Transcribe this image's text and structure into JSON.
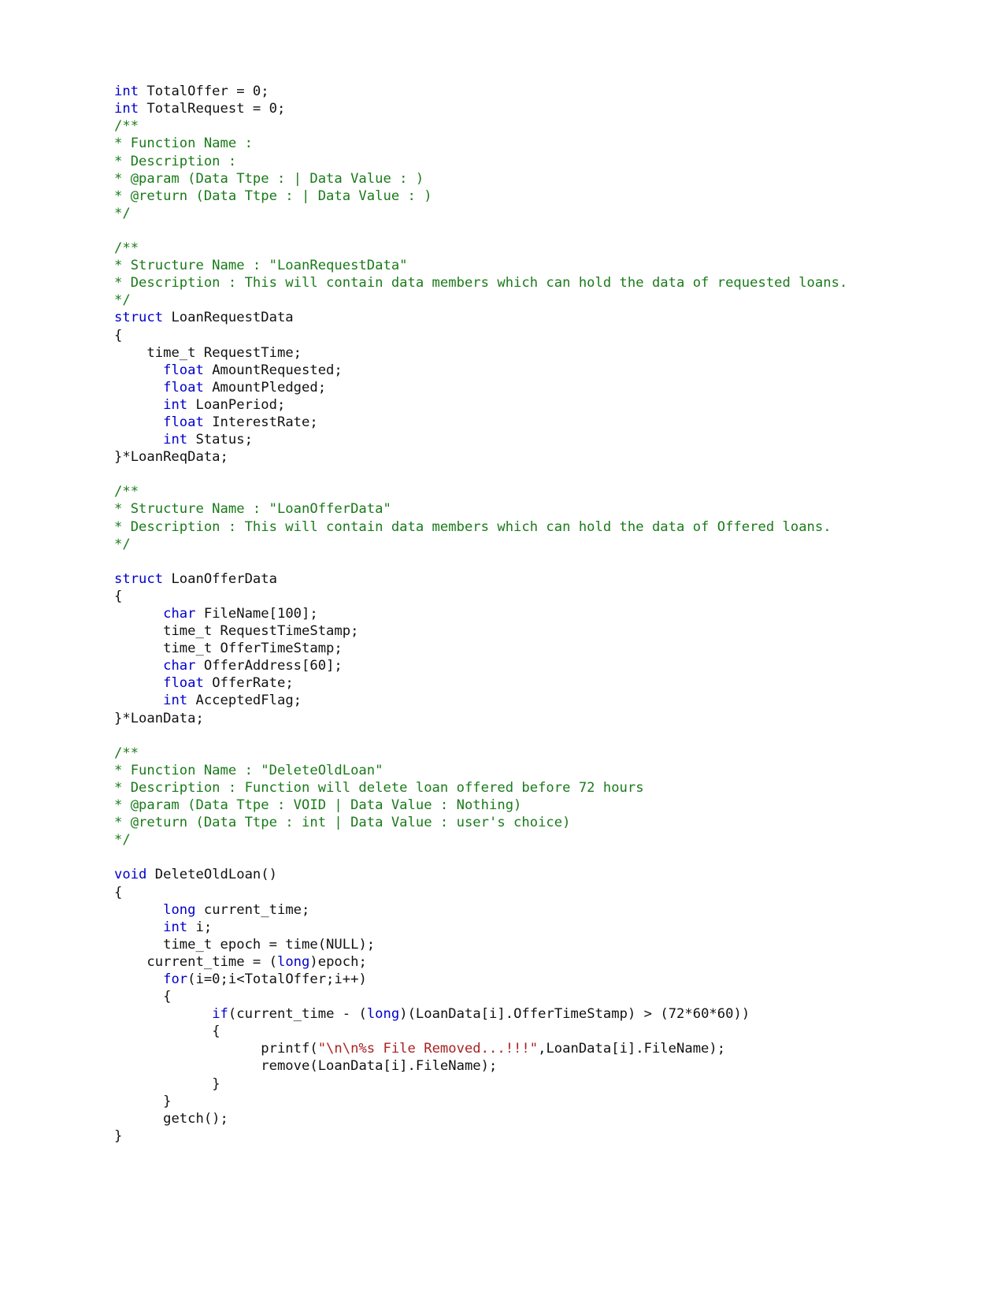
{
  "document": {
    "kind": "source-code-listing",
    "language": "C",
    "background_color": "#ffffff"
  },
  "syntax_colors": {
    "keyword": "#0000cd",
    "comment": "#1a7a1a",
    "string": "#aa2222",
    "plain": "#111111"
  },
  "code": {
    "lines": [
      {
        "id": "l1",
        "tokens": [
          {
            "t": "int",
            "c": "kw"
          },
          {
            "t": " TotalOffer = 0;",
            "c": "txt"
          }
        ]
      },
      {
        "id": "l2",
        "tokens": [
          {
            "t": "int",
            "c": "kw"
          },
          {
            "t": " TotalRequest = 0;",
            "c": "txt"
          }
        ]
      },
      {
        "id": "l3",
        "tokens": [
          {
            "t": "/**",
            "c": "cmt"
          }
        ]
      },
      {
        "id": "l4",
        "tokens": [
          {
            "t": "* Function Name :",
            "c": "cmt"
          }
        ]
      },
      {
        "id": "l5",
        "tokens": [
          {
            "t": "* Description :",
            "c": "cmt"
          }
        ]
      },
      {
        "id": "l6",
        "tokens": [
          {
            "t": "* @param (Data Ttpe : | Data Value : )",
            "c": "cmt"
          }
        ]
      },
      {
        "id": "l7",
        "tokens": [
          {
            "t": "* @return (Data Ttpe : | Data Value : )",
            "c": "cmt"
          }
        ]
      },
      {
        "id": "l8",
        "tokens": [
          {
            "t": "*/",
            "c": "cmt"
          }
        ]
      },
      {
        "id": "l9",
        "tokens": []
      },
      {
        "id": "l10",
        "tokens": [
          {
            "t": "/**",
            "c": "cmt"
          }
        ]
      },
      {
        "id": "l11",
        "tokens": [
          {
            "t": "* Structure Name : \"LoanRequestData\"",
            "c": "cmt"
          }
        ]
      },
      {
        "id": "l12",
        "tokens": [
          {
            "t": "* Description : This will contain data members which can hold the data of requested loans.",
            "c": "cmt"
          }
        ]
      },
      {
        "id": "l13",
        "tokens": [
          {
            "t": "*/",
            "c": "cmt"
          }
        ]
      },
      {
        "id": "l14",
        "tokens": [
          {
            "t": "struct",
            "c": "kw"
          },
          {
            "t": " LoanRequestData",
            "c": "txt"
          }
        ]
      },
      {
        "id": "l15",
        "tokens": [
          {
            "t": "{",
            "c": "txt"
          }
        ]
      },
      {
        "id": "l16",
        "tokens": [
          {
            "t": "    time_t RequestTime;",
            "c": "txt"
          }
        ]
      },
      {
        "id": "l17",
        "tokens": [
          {
            "t": "      ",
            "c": "txt"
          },
          {
            "t": "float",
            "c": "kw"
          },
          {
            "t": " AmountRequested;",
            "c": "txt"
          }
        ]
      },
      {
        "id": "l18",
        "tokens": [
          {
            "t": "      ",
            "c": "txt"
          },
          {
            "t": "float",
            "c": "kw"
          },
          {
            "t": " AmountPledged;",
            "c": "txt"
          }
        ]
      },
      {
        "id": "l19",
        "tokens": [
          {
            "t": "      ",
            "c": "txt"
          },
          {
            "t": "int",
            "c": "kw"
          },
          {
            "t": " LoanPeriod;",
            "c": "txt"
          }
        ]
      },
      {
        "id": "l20",
        "tokens": [
          {
            "t": "      ",
            "c": "txt"
          },
          {
            "t": "float",
            "c": "kw"
          },
          {
            "t": " InterestRate;",
            "c": "txt"
          }
        ]
      },
      {
        "id": "l21",
        "tokens": [
          {
            "t": "      ",
            "c": "txt"
          },
          {
            "t": "int",
            "c": "kw"
          },
          {
            "t": " Status;",
            "c": "txt"
          }
        ]
      },
      {
        "id": "l22",
        "tokens": [
          {
            "t": "}*LoanReqData;",
            "c": "txt"
          }
        ]
      },
      {
        "id": "l23",
        "tokens": []
      },
      {
        "id": "l24",
        "tokens": [
          {
            "t": "/**",
            "c": "cmt"
          }
        ]
      },
      {
        "id": "l25",
        "tokens": [
          {
            "t": "* Structure Name : \"LoanOfferData\"",
            "c": "cmt"
          }
        ]
      },
      {
        "id": "l26",
        "tokens": [
          {
            "t": "* Description : This will contain data members which can hold the data of Offered loans.",
            "c": "cmt"
          }
        ]
      },
      {
        "id": "l27",
        "tokens": [
          {
            "t": "*/",
            "c": "cmt"
          }
        ]
      },
      {
        "id": "l28",
        "tokens": []
      },
      {
        "id": "l29",
        "tokens": [
          {
            "t": "struct",
            "c": "kw"
          },
          {
            "t": " LoanOfferData",
            "c": "txt"
          }
        ]
      },
      {
        "id": "l30",
        "tokens": [
          {
            "t": "{",
            "c": "txt"
          }
        ]
      },
      {
        "id": "l31",
        "tokens": [
          {
            "t": "      ",
            "c": "txt"
          },
          {
            "t": "char",
            "c": "kw"
          },
          {
            "t": " FileName[100];",
            "c": "txt"
          }
        ]
      },
      {
        "id": "l32",
        "tokens": [
          {
            "t": "      time_t RequestTimeStamp;",
            "c": "txt"
          }
        ]
      },
      {
        "id": "l33",
        "tokens": [
          {
            "t": "      time_t OfferTimeStamp;",
            "c": "txt"
          }
        ]
      },
      {
        "id": "l34",
        "tokens": [
          {
            "t": "      ",
            "c": "txt"
          },
          {
            "t": "char",
            "c": "kw"
          },
          {
            "t": " OfferAddress[60];",
            "c": "txt"
          }
        ]
      },
      {
        "id": "l35",
        "tokens": [
          {
            "t": "      ",
            "c": "txt"
          },
          {
            "t": "float",
            "c": "kw"
          },
          {
            "t": " OfferRate;",
            "c": "txt"
          }
        ]
      },
      {
        "id": "l36",
        "tokens": [
          {
            "t": "      ",
            "c": "txt"
          },
          {
            "t": "int",
            "c": "kw"
          },
          {
            "t": " AcceptedFlag;",
            "c": "txt"
          }
        ]
      },
      {
        "id": "l37",
        "tokens": [
          {
            "t": "}*LoanData;",
            "c": "txt"
          }
        ]
      },
      {
        "id": "l38",
        "tokens": []
      },
      {
        "id": "l39",
        "tokens": [
          {
            "t": "/**",
            "c": "cmt"
          }
        ]
      },
      {
        "id": "l40",
        "tokens": [
          {
            "t": "* Function Name : \"DeleteOldLoan\"",
            "c": "cmt"
          }
        ]
      },
      {
        "id": "l41",
        "tokens": [
          {
            "t": "* Description : Function will delete loan offered before 72 hours",
            "c": "cmt"
          }
        ]
      },
      {
        "id": "l42",
        "tokens": [
          {
            "t": "* @param (Data Ttpe : VOID | Data Value : Nothing)",
            "c": "cmt"
          }
        ]
      },
      {
        "id": "l43",
        "tokens": [
          {
            "t": "* @return (Data Ttpe : int | Data Value : user's choice)",
            "c": "cmt"
          }
        ]
      },
      {
        "id": "l44",
        "tokens": [
          {
            "t": "*/",
            "c": "cmt"
          }
        ]
      },
      {
        "id": "l45",
        "tokens": []
      },
      {
        "id": "l46",
        "tokens": [
          {
            "t": "void",
            "c": "kw"
          },
          {
            "t": " DeleteOldLoan()",
            "c": "txt"
          }
        ]
      },
      {
        "id": "l47",
        "tokens": [
          {
            "t": "{",
            "c": "txt"
          }
        ]
      },
      {
        "id": "l48",
        "tokens": [
          {
            "t": "      ",
            "c": "txt"
          },
          {
            "t": "long",
            "c": "kw"
          },
          {
            "t": " current_time;",
            "c": "txt"
          }
        ]
      },
      {
        "id": "l49",
        "tokens": [
          {
            "t": "      ",
            "c": "txt"
          },
          {
            "t": "int",
            "c": "kw"
          },
          {
            "t": " i;",
            "c": "txt"
          }
        ]
      },
      {
        "id": "l50",
        "tokens": [
          {
            "t": "      time_t epoch = time(NULL);",
            "c": "txt"
          }
        ]
      },
      {
        "id": "l51",
        "tokens": [
          {
            "t": "    current_time = (",
            "c": "txt"
          },
          {
            "t": "long",
            "c": "kw"
          },
          {
            "t": ")epoch;",
            "c": "txt"
          }
        ]
      },
      {
        "id": "l52",
        "tokens": [
          {
            "t": "      ",
            "c": "txt"
          },
          {
            "t": "for",
            "c": "kw"
          },
          {
            "t": "(i=0;i<TotalOffer;i++)",
            "c": "txt"
          }
        ]
      },
      {
        "id": "l53",
        "tokens": [
          {
            "t": "      {",
            "c": "txt"
          }
        ]
      },
      {
        "id": "l54",
        "tokens": [
          {
            "t": "            ",
            "c": "txt"
          },
          {
            "t": "if",
            "c": "kw"
          },
          {
            "t": "(current_time - (",
            "c": "txt"
          },
          {
            "t": "long",
            "c": "kw"
          },
          {
            "t": ")(LoanData[i].OfferTimeStamp) > (72*60*60))",
            "c": "txt"
          }
        ]
      },
      {
        "id": "l55",
        "tokens": [
          {
            "t": "            {",
            "c": "txt"
          }
        ]
      },
      {
        "id": "l56",
        "tokens": [
          {
            "t": "                  printf(",
            "c": "txt"
          },
          {
            "t": "\"\\n\\n%s File Removed...!!!\"",
            "c": "str"
          },
          {
            "t": ",LoanData[i].FileName);",
            "c": "txt"
          }
        ]
      },
      {
        "id": "l57",
        "tokens": [
          {
            "t": "                  remove(LoanData[i].FileName);",
            "c": "txt"
          }
        ]
      },
      {
        "id": "l58",
        "tokens": [
          {
            "t": "            }",
            "c": "txt"
          }
        ]
      },
      {
        "id": "l59",
        "tokens": [
          {
            "t": "      }",
            "c": "txt"
          }
        ]
      },
      {
        "id": "l60",
        "tokens": [
          {
            "t": "      getch();",
            "c": "txt"
          }
        ]
      },
      {
        "id": "l61",
        "tokens": [
          {
            "t": "}",
            "c": "txt"
          }
        ]
      }
    ]
  }
}
